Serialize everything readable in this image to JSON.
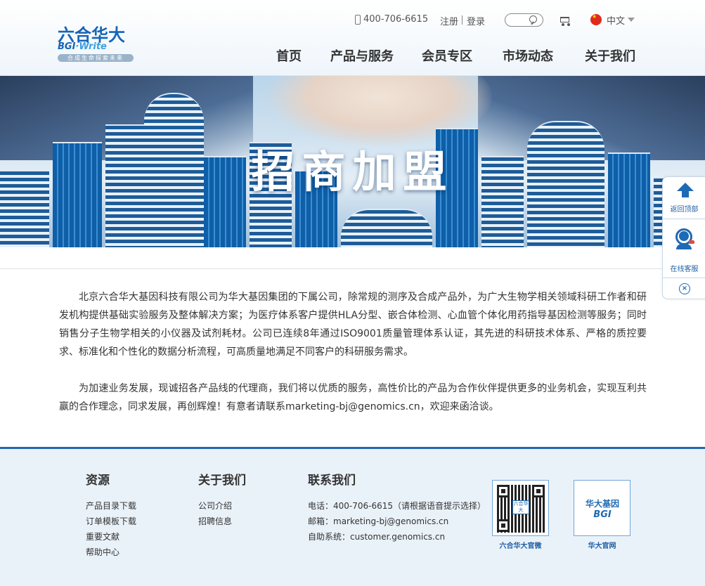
{
  "header": {
    "logo": {
      "cn": "六合华大",
      "en_brand": "BGI",
      "en_dot": "·",
      "en_word": "Write",
      "slogan": "合成生命探索未来"
    },
    "phone": "400-706-6615",
    "register": "注册",
    "login": "登录",
    "language": "中文",
    "nav": [
      "首页",
      "产品与服务",
      "会员专区",
      "市场动态",
      "关于我们"
    ]
  },
  "banner": {
    "title": "招商加盟"
  },
  "content": {
    "paragraphs": [
      "北京六合华大基因科技有限公司为华大基因集团的下属公司，除常规的测序及合成产品外，为广大生物学相关领域科研工作者和研发机构提供基础实验服务及整体解决方案；为医疗体系客户提供HLA分型、嵌合体检测、心血管个体化用药指导基因检测等服务；同时销售分子生物学相关的小仪器及试剂耗材。公司已连续8年通过ISO9001质量管理体系认证，其先进的科研技术体系、严格的质控要求、标准化和个性化的数据分析流程，可高质量地满足不同客户的科研服务需求。",
      "为加速业务发展，现诚招各产品线的代理商，我们将以优质的服务，高性价比的产品为合作伙伴提供更多的业务机会，实现互利共赢的合作理念，同求发展，再创辉煌！有意者请联系marketing-bj@genomics.cn，欢迎来函洽谈。"
    ]
  },
  "float_panel": {
    "back_to_top": "返回顶部",
    "online_service": "在线客服",
    "close": "×"
  },
  "footer": {
    "resources": {
      "title": "资源",
      "items": [
        "产品目录下载",
        "订单模板下载",
        "重要文献",
        "帮助中心"
      ]
    },
    "about": {
      "title": "关于我们",
      "items": [
        "公司介绍",
        "招聘信息"
      ]
    },
    "contact": {
      "title": "联系我们",
      "items": [
        "电话：400-706-6615（请根据语音提示选择）",
        "邮箱：marketing-bj@genomics.cn",
        "自助系统：customer.genomics.cn"
      ]
    },
    "qr_wechat": {
      "caption": "六合华大官微",
      "center": "六合华大"
    },
    "qr_site": {
      "caption": "华大官网",
      "logo_cn": "华大基因",
      "logo_en": "BGI"
    }
  },
  "colors": {
    "brand_blue": "#1f6ab3",
    "footer_bg": "#eaf2f9",
    "banner_title": "#ffffff"
  }
}
